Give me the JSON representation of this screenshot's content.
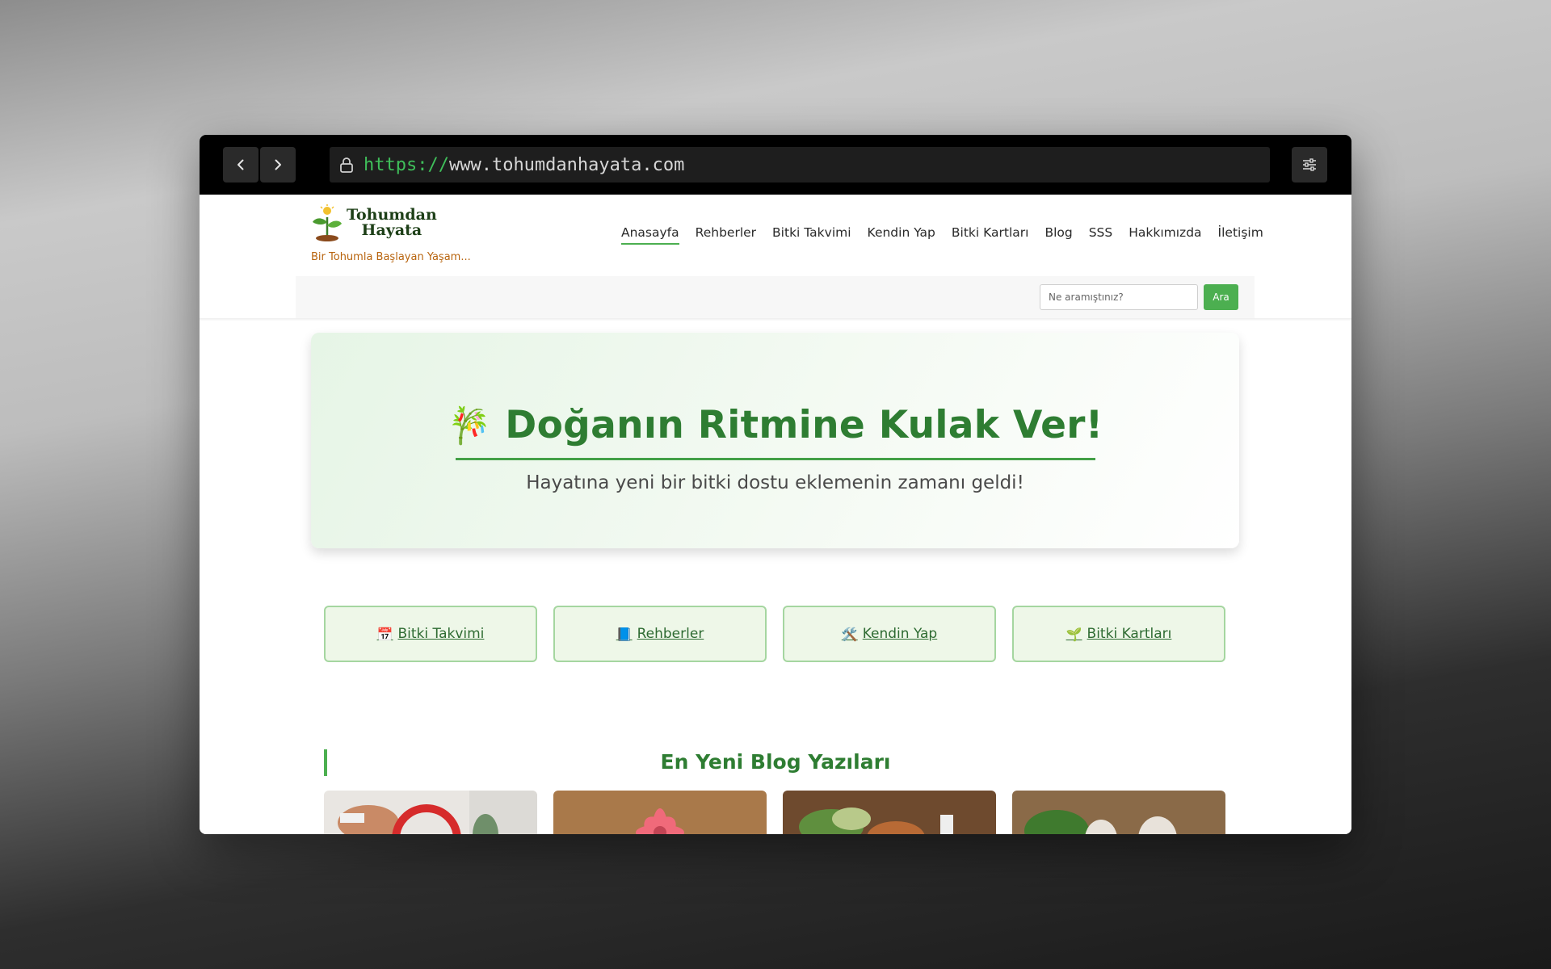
{
  "browser": {
    "url_scheme": "https://",
    "url_host": "www.tohumdanhayata.com"
  },
  "site": {
    "logo_line1": "Tohumdan",
    "logo_line2": "Hayata",
    "tagline": "Bir Tohumla Başlayan Yaşam...",
    "nav": [
      {
        "label": "Anasayfa",
        "active": true
      },
      {
        "label": "Rehberler"
      },
      {
        "label": "Bitki Takvimi"
      },
      {
        "label": "Kendin Yap"
      },
      {
        "label": "Bitki Kartları"
      },
      {
        "label": "Blog"
      },
      {
        "label": "SSS"
      },
      {
        "label": "Hakkımızda"
      },
      {
        "label": "İletişim"
      }
    ],
    "search": {
      "placeholder": "Ne aramıştınız?",
      "button": "Ara"
    }
  },
  "hero": {
    "emoji": "🎋",
    "title": "Doğanın Ritmine Kulak Ver!",
    "subtitle": "Hayatına yeni bir bitki dostu eklemenin zamanı geldi!"
  },
  "quick_links": [
    {
      "icon": "📅",
      "label": "Bitki Takvimi"
    },
    {
      "icon": "📘",
      "label": "Rehberler"
    },
    {
      "icon": "🛠️",
      "label": "Kendin Yap"
    },
    {
      "icon": "🌱",
      "label": "Bitki Kartları"
    }
  ],
  "blog": {
    "section_title": "En Yeni Blog Yazıları"
  },
  "colors": {
    "accent": "#4caf50",
    "title_green": "#2e7d32",
    "tagline_orange": "#b8640e"
  }
}
